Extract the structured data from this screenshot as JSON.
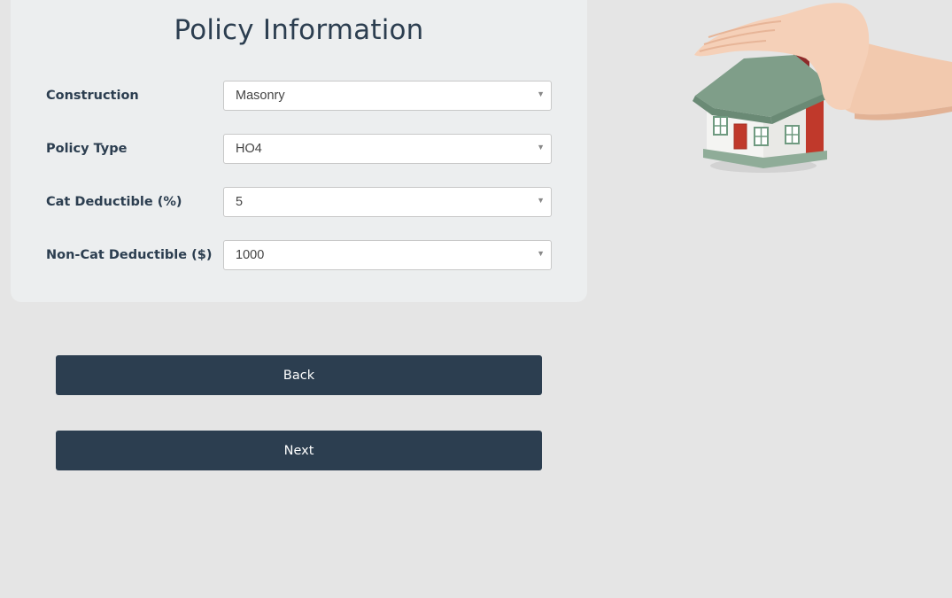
{
  "form": {
    "title": "Policy Information",
    "fields": [
      {
        "label": "Construction",
        "value": "Masonry"
      },
      {
        "label": "Policy Type",
        "value": "HO4"
      },
      {
        "label": "Cat Deductible (%)",
        "value": "5"
      },
      {
        "label": "Non-Cat Deductible ($)",
        "value": "1000"
      }
    ]
  },
  "buttons": {
    "back_label": "Back",
    "next_label": "Next"
  },
  "icons": {
    "dropdown": "chevron-down-icon",
    "illustration": "house-in-hand-icon"
  },
  "colors": {
    "page_background": "#e5e5e5",
    "card_background": "#eceeef",
    "primary": "#2c3e50",
    "button_text": "#ffffff"
  }
}
